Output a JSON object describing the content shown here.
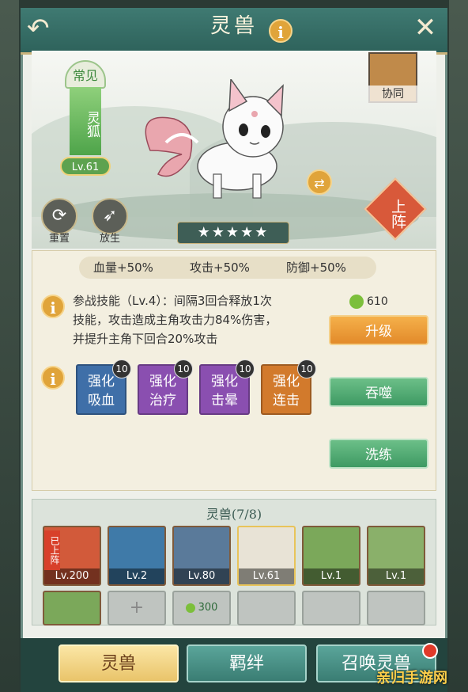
{
  "header": {
    "title": "灵兽",
    "info_icon": "i"
  },
  "pet": {
    "rarity": "常见",
    "name": "灵狐",
    "level": "Lv.61",
    "stars": "★★★★★",
    "collab_label": "协同",
    "deploy_label": "上阵"
  },
  "actions_left": [
    {
      "label": "重置",
      "icon": "refresh-icon"
    },
    {
      "label": "放生",
      "icon": "bird-icon"
    }
  ],
  "stats": [
    "血量+50%",
    "攻击+50%",
    "防御+50%"
  ],
  "skill": {
    "line1": "参战技能（Lv.4）：间隔3回合释放1次",
    "line2": "技能，攻击造成主角攻击力84%伤害，",
    "line3": "并提升主角下回合20%攻击"
  },
  "upgrade_cost": "610",
  "buttons": {
    "upgrade": "升级",
    "devour": "吞噬",
    "refine": "洗练"
  },
  "enhancements": [
    {
      "line1": "强化",
      "line2": "吸血",
      "level": "10",
      "color": "#3f6fa8"
    },
    {
      "line1": "强化",
      "line2": "治疗",
      "level": "10",
      "color": "#8a4fb0"
    },
    {
      "line1": "强化",
      "line2": "击晕",
      "level": "10",
      "color": "#8a4fb0"
    },
    {
      "line1": "强化",
      "line2": "连击",
      "level": "10",
      "color": "#d27a2c"
    }
  ],
  "roster": {
    "title": "灵兽(7/8)",
    "deployed_tag": "已上阵",
    "cards": [
      {
        "level": "Lv.200",
        "color": "#d25a3a"
      },
      {
        "level": "Lv.2",
        "color": "#3f7aa8"
      },
      {
        "level": "Lv.80",
        "color": "#5a7a9a"
      },
      {
        "level": "Lv.61",
        "color": "#e8e3d6"
      },
      {
        "level": "Lv.1",
        "color": "#7ba85a"
      },
      {
        "level": "Lv.1",
        "color": "#8ab06a"
      }
    ],
    "unlock_cost": "300"
  },
  "tabs": [
    "灵兽",
    "羁绊",
    "召唤灵兽"
  ],
  "watermark": "亲归手游网"
}
